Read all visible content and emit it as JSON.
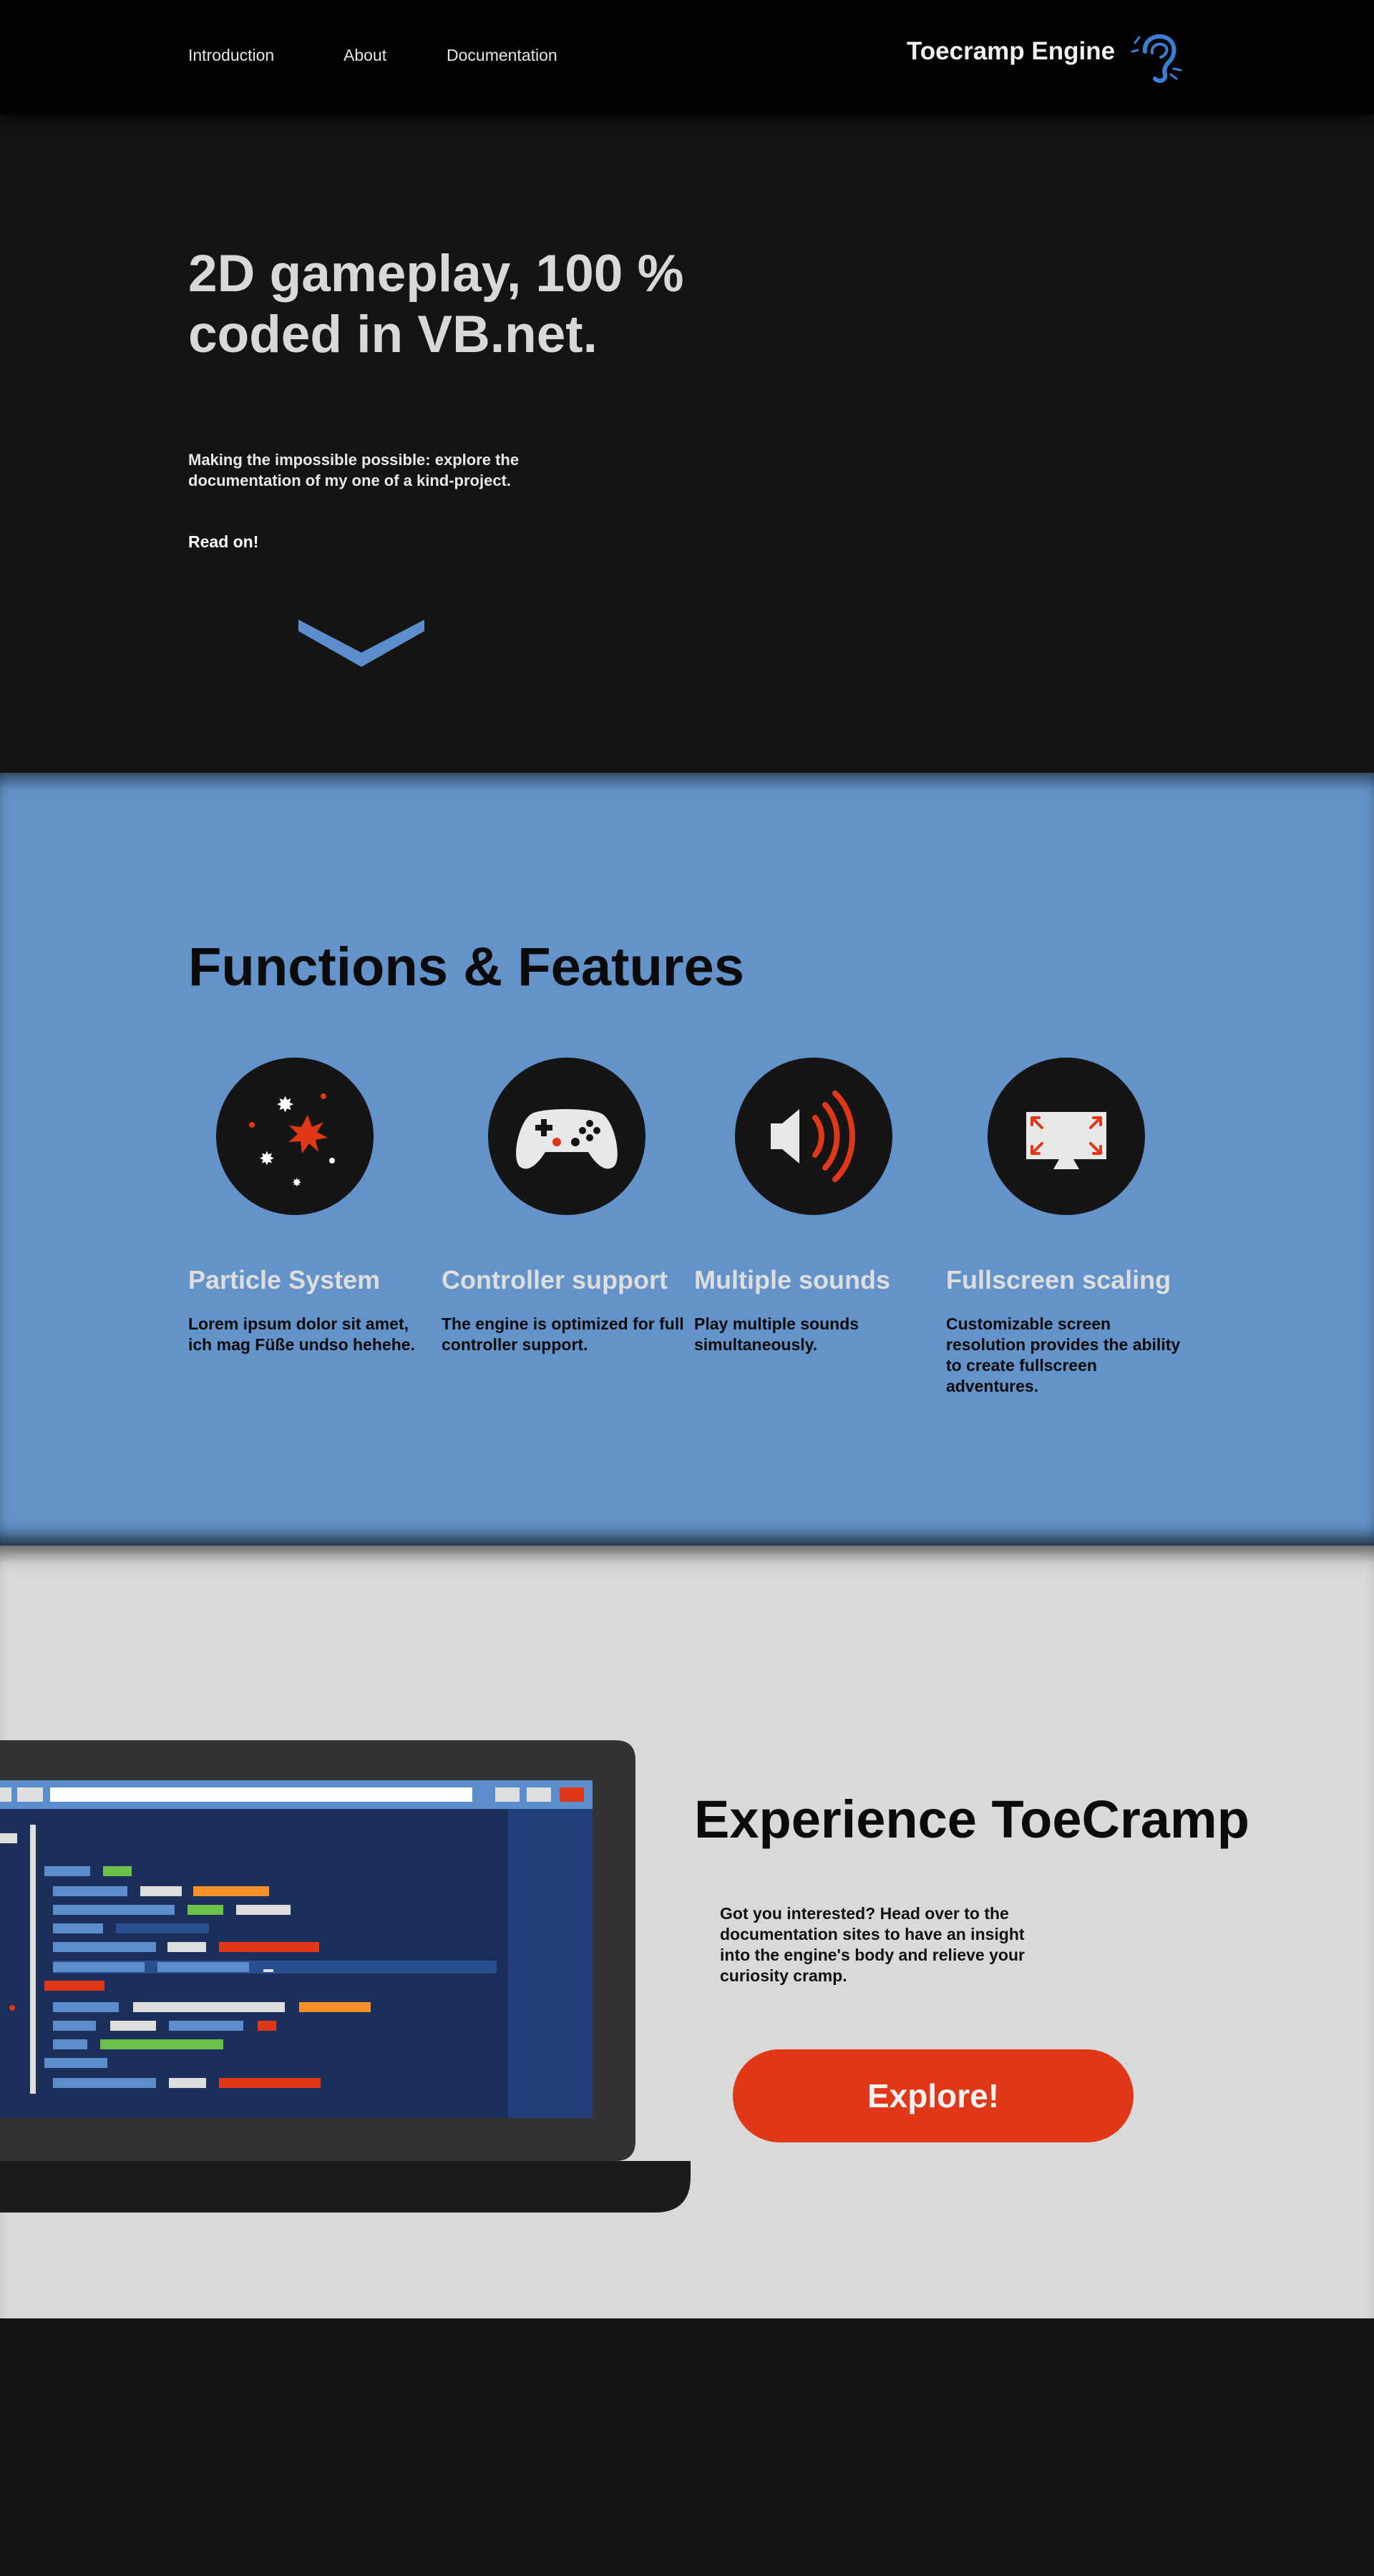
{
  "nav": {
    "links": [
      "Introduction",
      "About",
      "Documentation"
    ],
    "brand": "Toecramp Engine",
    "brand_logo": "ear-icon"
  },
  "hero": {
    "title": "2D gameplay, 100 % coded in VB.net.",
    "subtitle": "Making the impossible possible: explore the documentation of my one of a kind-project.",
    "read_on": "Read on!",
    "scroll_icon": "chevron-down-icon"
  },
  "features": {
    "title": "Functions & Features",
    "items": [
      {
        "icon": "particles-icon",
        "title": "Particle System",
        "desc": "Lorem ipsum dolor sit amet, ich mag Füße undso hehehe."
      },
      {
        "icon": "gamepad-icon",
        "title": "Controller support",
        "desc": "The engine is optimized for full controller support."
      },
      {
        "icon": "speaker-icon",
        "title": "Multiple sounds",
        "desc": "Play multiple sounds simultaneously."
      },
      {
        "icon": "fullscreen-monitor-icon",
        "title": "Fullscreen scaling",
        "desc": "Customizable screen resolution provides the ability to create fullscreen adventures."
      }
    ]
  },
  "experience": {
    "title": "Experience ToeCramp",
    "body": "Got you interested? Head over to the documentation sites to have an insight into the engine's body and relieve your curiosity cramp.",
    "button": "Explore!",
    "illustration": "laptop-code-editor"
  },
  "colors": {
    "accent_blue": "#6493c9",
    "accent_red": "#e03718",
    "dark": "#141414",
    "light": "#d9d9d9"
  }
}
